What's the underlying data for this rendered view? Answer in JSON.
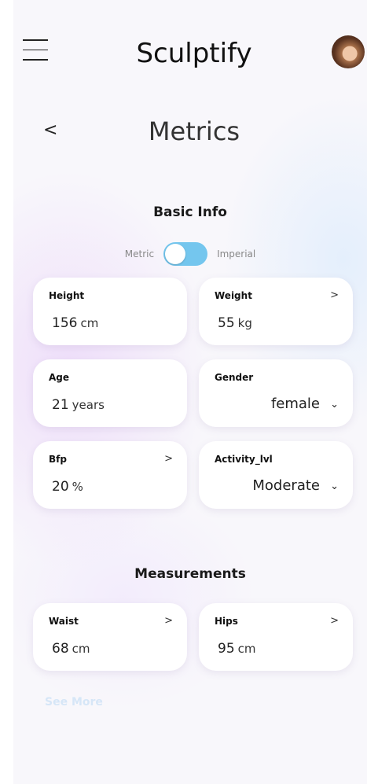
{
  "header": {
    "app_title": "Sculptify",
    "menu_icon": "hamburger-menu-icon",
    "avatar_icon": "user-avatar"
  },
  "page": {
    "back_icon": "chevron-left-icon",
    "back_glyph": "<",
    "title": "Metrics"
  },
  "basic_info": {
    "title": "Basic Info",
    "toggle": {
      "left_label": "Metric",
      "right_label": "Imperial",
      "state": "metric",
      "color": "#74c6ee"
    },
    "height": {
      "label": "Height",
      "value": "156",
      "unit": "cm"
    },
    "weight": {
      "label": "Weight",
      "value": "55",
      "unit": "kg",
      "chevron": ">"
    },
    "age": {
      "label": "Age",
      "value": "21",
      "unit": "years"
    },
    "gender": {
      "label": "Gender",
      "value": "female",
      "caret": "⌄"
    },
    "bfp": {
      "label": "Bfp",
      "value": "20",
      "unit": "%",
      "chevron": ">"
    },
    "activity": {
      "label": "Activity_lvl",
      "value": "Moderate",
      "caret": "⌄"
    }
  },
  "measurements": {
    "title": "Measurements",
    "waist": {
      "label": "Waist",
      "value": "68",
      "unit": "cm",
      "chevron": ">"
    },
    "hips": {
      "label": "Hips",
      "value": "95",
      "unit": "cm",
      "chevron": ">"
    }
  },
  "see_more": "See More"
}
